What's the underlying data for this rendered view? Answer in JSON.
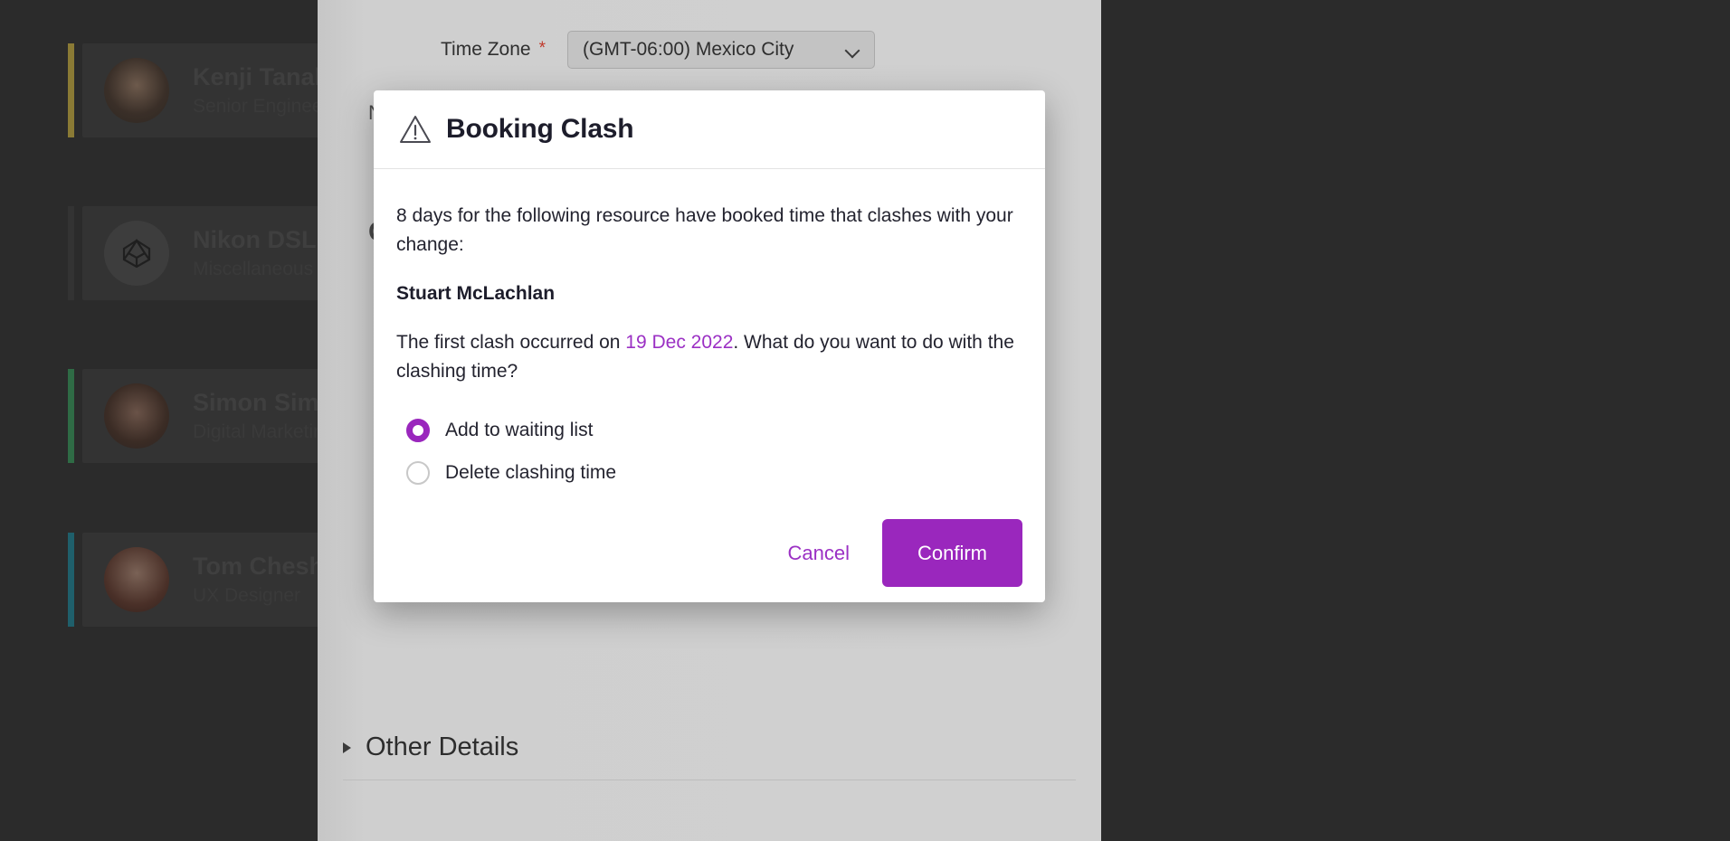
{
  "theme": {
    "accent_purple": "#9a27bd",
    "link_purple": "#9b30c4",
    "modal_bg": "#ffffff",
    "panel_bg": "#d0d0d0",
    "app_bg": "#2b2b2b",
    "required_red": "#c0392b"
  },
  "resource_list": {
    "items": [
      {
        "name": "Kenji Tanaka",
        "role": "Senior Engineer",
        "accent": "#8a7a35",
        "avatar": "photo-avatar"
      },
      {
        "name": "Nikon DSLR C",
        "role": "Miscellaneous",
        "accent": "#333333",
        "avatar": "polyhedron-icon"
      },
      {
        "name": "Simon Simps",
        "role": "Digital Marketing M",
        "accent": "#2f6b45",
        "avatar": "photo-avatar"
      },
      {
        "name": "Tom Cheshire",
        "role": "UX Designer",
        "accent": "#1f5f6b",
        "avatar": "photo-avatar"
      }
    ]
  },
  "form": {
    "time_zone_label": "Time Zone",
    "required_marker": "*",
    "time_zone_value": "(GMT-06:00) Mexico City",
    "ghost_name": "N",
    "ghost_heading": "C",
    "ghost_sub": "(",
    "other_details_label": "Other Details"
  },
  "modal": {
    "title": "Booking Clash",
    "icon": "warning-triangle-icon",
    "message_line": "8 days for the following resource have booked time that clashes with your change:",
    "resource_name": "Stuart McLachlan",
    "question_prefix": "The first clash occurred on ",
    "question_date": "19 Dec 2022",
    "question_suffix": ". What do you want to do with the clashing time?",
    "options": [
      {
        "label": "Add to waiting list",
        "selected": true
      },
      {
        "label": "Delete clashing time",
        "selected": false
      }
    ],
    "cancel_label": "Cancel",
    "confirm_label": "Confirm"
  }
}
